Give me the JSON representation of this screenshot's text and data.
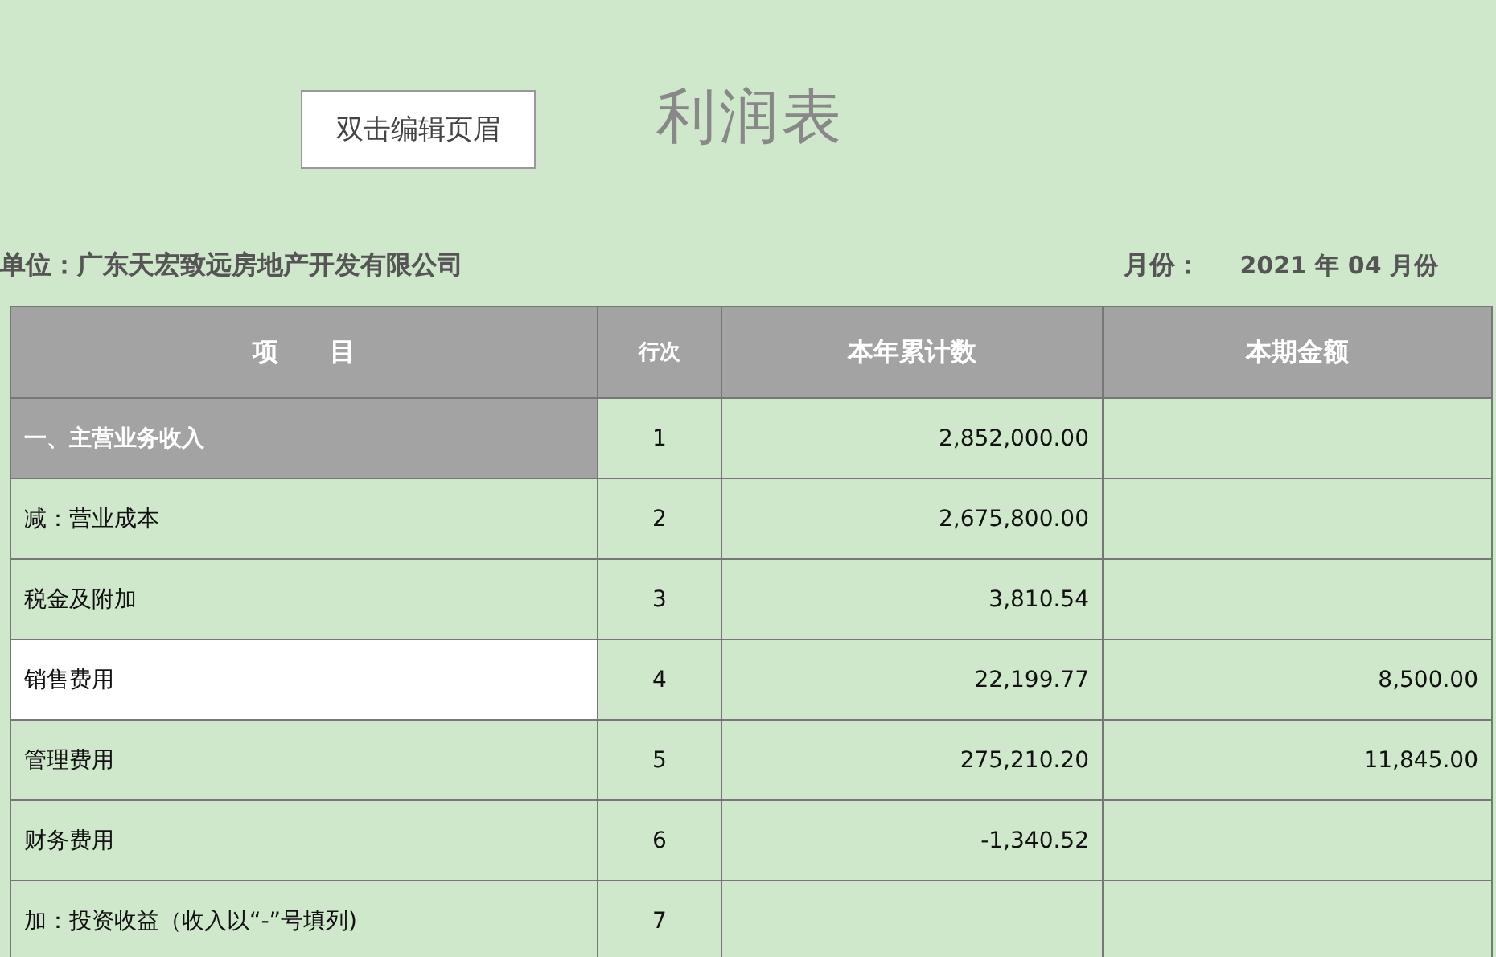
{
  "header_button": "双击编辑页眉",
  "title": "利润表",
  "unit": "单位：广东天宏致远房地产开发有限公司",
  "month_label": "月份：",
  "month_value": "2021 年 04 月份",
  "table": {
    "columns": [
      "项　　目",
      "行次",
      "本年累计数",
      "本期金额"
    ],
    "rows": [
      {
        "item": "一、主营业务收入",
        "line": "1",
        "ytd": "2,852,000.00",
        "kind": "heading"
      },
      {
        "item": "减：营业成本",
        "line": "2",
        "ytd": "2,675,800.00"
      },
      {
        "item": "税金及附加",
        "line": "3",
        "ytd": "3,810.54"
      },
      {
        "item": "销售费用",
        "line": "4",
        "ytd": "22,199.77",
        "period": "8,500.00",
        "kind": "highlighted"
      },
      {
        "item": "管理费用",
        "line": "5",
        "ytd": "275,210.20",
        "period": "11,845.00"
      },
      {
        "item": "财务费用",
        "line": "6",
        "ytd": "-1,340.52"
      },
      {
        "item": "加：投资收益（收入以“-”号填列)",
        "line": "7"
      }
    ]
  }
}
